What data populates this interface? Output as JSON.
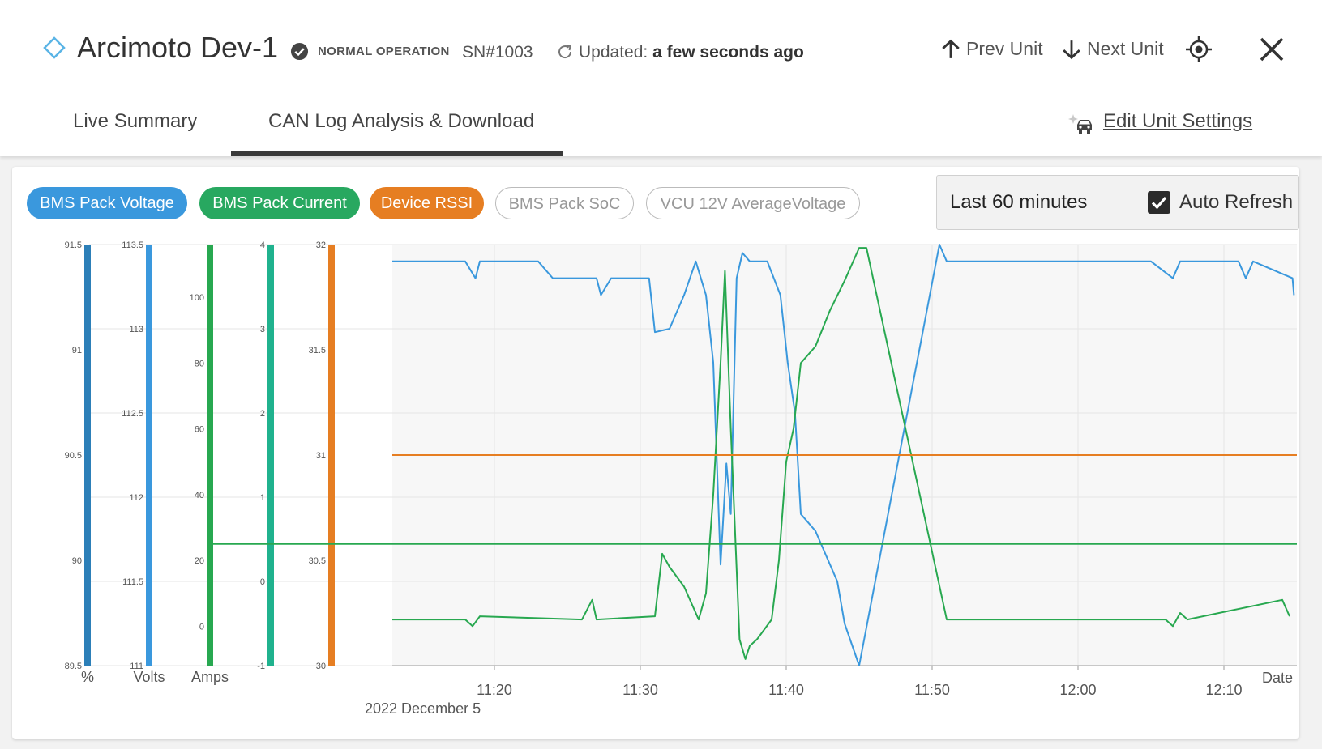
{
  "header": {
    "unit_name": "Arcimoto Dev-1",
    "status": "NORMAL OPERATION",
    "serial": "SN#1003",
    "updated_label": "Updated:",
    "updated_value": "a few seconds ago",
    "prev_unit": "Prev Unit",
    "next_unit": "Next Unit"
  },
  "tabs": [
    {
      "label": "Live Summary",
      "active": false
    },
    {
      "label": "CAN Log Analysis & Download",
      "active": true
    }
  ],
  "edit_settings": "Edit Unit Settings",
  "filters": [
    {
      "label": "BMS Pack Voltage",
      "active": true,
      "color": "#3a98dd"
    },
    {
      "label": "BMS Pack Current",
      "active": true,
      "color": "#28a860"
    },
    {
      "label": "Device RSSI",
      "active": true,
      "color": "#e67e22"
    },
    {
      "label": "BMS Pack SoC",
      "active": false,
      "color": "#999999"
    },
    {
      "label": "VCU 12V AverageVoltage",
      "active": false,
      "color": "#999999"
    }
  ],
  "time_range": "Last 60 minutes",
  "auto_refresh": {
    "label": "Auto Refresh",
    "checked": true
  },
  "chart_data": {
    "type": "line",
    "xlabel": "Date",
    "x_date_label": "2022 December  5",
    "x_ticks": [
      "11:20",
      "11:30",
      "11:40",
      "11:50",
      "12:00",
      "12:10"
    ],
    "xlim": [
      "11:13",
      "12:15"
    ],
    "grid": true,
    "axes": [
      {
        "unit": "%",
        "color": "#2c7fb8",
        "ylim": [
          89.5,
          91.5
        ],
        "ticks": [
          "91.5",
          "91",
          "90.5",
          "90",
          "89.5"
        ]
      },
      {
        "unit": "Volts",
        "color": "#3a98dd",
        "ylim": [
          111,
          113.5
        ],
        "ticks": [
          "113.5",
          "113",
          "112.5",
          "112",
          "111.5",
          "111"
        ]
      },
      {
        "unit": "Amps",
        "color": "#28a850",
        "ylim": [
          -12,
          116
        ],
        "ticks": [
          "100",
          "80",
          "60",
          "40",
          "20",
          "0"
        ]
      },
      {
        "unit": "",
        "color": "#20b28e",
        "ylim": [
          -1,
          4
        ],
        "ticks": [
          "4",
          "3",
          "2",
          "1",
          "0",
          "-1"
        ]
      },
      {
        "unit": "",
        "color": "#e67e22",
        "ylim": [
          30,
          32
        ],
        "ticks": [
          "32",
          "31.5",
          "31",
          "30.5",
          "30"
        ]
      }
    ],
    "series": [
      {
        "name": "BMS Pack Voltage",
        "axis": "Volts",
        "color": "#3a98dd",
        "points": [
          [
            "11:13",
            113.4
          ],
          [
            "11:18",
            113.4
          ],
          [
            "11:18.7",
            113.3
          ],
          [
            "11:19",
            113.4
          ],
          [
            "11:23",
            113.4
          ],
          [
            "11:24",
            113.3
          ],
          [
            "11:27",
            113.3
          ],
          [
            "11:27.3",
            113.2
          ],
          [
            "11:28",
            113.3
          ],
          [
            "11:30.6",
            113.3
          ],
          [
            "11:31",
            112.98
          ],
          [
            "11:32",
            113.0
          ],
          [
            "11:33",
            113.2
          ],
          [
            "11:33.8",
            113.4
          ],
          [
            "11:34.5",
            113.2
          ],
          [
            "11:35",
            112.8
          ],
          [
            "11:35.5",
            111.6
          ],
          [
            "11:35.9",
            112.2
          ],
          [
            "11:36.2",
            111.9
          ],
          [
            "11:36.6",
            113.3
          ],
          [
            "11:37",
            113.45
          ],
          [
            "11:37.5",
            113.4
          ],
          [
            "11:38.7",
            113.4
          ],
          [
            "11:39.6",
            113.2
          ],
          [
            "11:40.1",
            112.8
          ],
          [
            "11:40.6",
            112.5
          ],
          [
            "11:41",
            111.9
          ],
          [
            "11:42",
            111.8
          ],
          [
            "11:43.5",
            111.5
          ],
          [
            "11:44",
            111.25
          ],
          [
            "11:45",
            111.0
          ],
          [
            "11:50.5",
            113.5
          ],
          [
            "11:51",
            113.4
          ],
          [
            "12:05",
            113.4
          ],
          [
            "12:06.5",
            113.3
          ],
          [
            "12:07",
            113.4
          ],
          [
            "12:11",
            113.4
          ],
          [
            "12:11.5",
            113.3
          ],
          [
            "12:12",
            113.4
          ],
          [
            "12:14.7",
            113.3
          ],
          [
            "12:14.8",
            113.2
          ]
        ]
      },
      {
        "name": "BMS Pack Current",
        "axis": "Amps",
        "color": "#28a850",
        "points": [
          [
            "11:13",
            2
          ],
          [
            "11:18",
            2
          ],
          [
            "11:18.5",
            0
          ],
          [
            "11:19",
            3
          ],
          [
            "11:26",
            2
          ],
          [
            "11:26.7",
            8
          ],
          [
            "11:27",
            2
          ],
          [
            "11:31",
            3
          ],
          [
            "11:31.5",
            22
          ],
          [
            "11:32",
            18
          ],
          [
            "11:33",
            12
          ],
          [
            "11:34",
            2
          ],
          [
            "11:34.5",
            10
          ],
          [
            "11:35",
            40
          ],
          [
            "11:35.5",
            80
          ],
          [
            "11:35.8",
            108
          ],
          [
            "11:36.2",
            60
          ],
          [
            "11:36.8",
            -4
          ],
          [
            "11:37.2",
            -10
          ],
          [
            "11:37.5",
            -6
          ],
          [
            "11:38",
            -4
          ],
          [
            "11:39",
            2
          ],
          [
            "11:39.5",
            20
          ],
          [
            "11:40",
            50
          ],
          [
            "11:40.5",
            60
          ],
          [
            "11:41",
            80
          ],
          [
            "11:42",
            85
          ],
          [
            "11:43",
            96
          ],
          [
            "11:44",
            105
          ],
          [
            "11:45",
            115
          ],
          [
            "11:45.5",
            115
          ],
          [
            "11:51",
            2
          ],
          [
            "11:52",
            2
          ],
          [
            "12:06",
            2
          ],
          [
            "12:06.5",
            0
          ],
          [
            "12:07",
            4
          ],
          [
            "12:07.5",
            2
          ],
          [
            "12:14",
            8
          ],
          [
            "12:14.5",
            3
          ]
        ]
      },
      {
        "name": "Device RSSI",
        "axis": "Amps",
        "color": "#e67e22",
        "points": [
          [
            "11:13",
            52
          ],
          [
            "12:15",
            52
          ]
        ]
      },
      {
        "name": "Device RSSI",
        "axis": "Amps",
        "color": "#28a850",
        "points": [
          [
            "11:13",
            25
          ],
          [
            "12:15",
            25
          ]
        ]
      }
    ]
  }
}
